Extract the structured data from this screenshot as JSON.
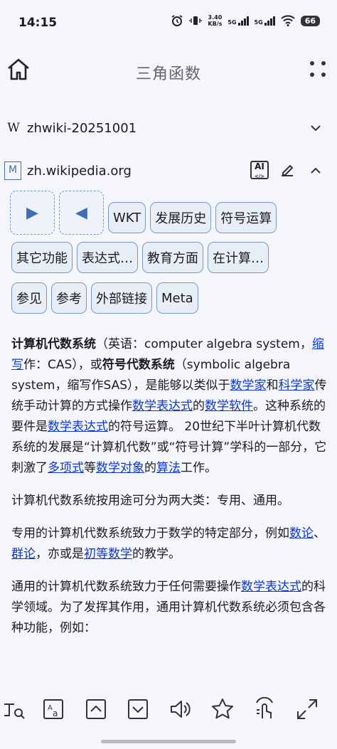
{
  "status_bar": {
    "time": "14:15",
    "net_speed_value": "3.40",
    "net_speed_unit": "KB/s",
    "sim1": "5G",
    "sim2": "5G",
    "battery": "66"
  },
  "app_bar": {
    "title": "三角函数"
  },
  "sources": [
    {
      "icon": "W",
      "label": "zhwiki-20251001"
    },
    {
      "icon": "M",
      "label": "zh.wikipedia.org"
    }
  ],
  "ai_label": "AI",
  "section_chips": {
    "row1": [
      "WKT",
      "发展历史",
      "符号运算"
    ],
    "row2": [
      "其它功能",
      "表达式…",
      "教育方面",
      "在计算…"
    ],
    "row3": [
      "参见",
      "参考",
      "外部链接",
      "Meta"
    ]
  },
  "article": {
    "p1": {
      "t1": "计算机代数系统",
      "t2": "（英语：computer algebra system，",
      "l1": "缩写",
      "t3": "作：CAS），或",
      "t4": "符号代数系统",
      "t5": "（symbolic algebra system，缩写作SAS），是能够以类似于",
      "l2": "数学家",
      "t6": "和",
      "l3": "科学家",
      "t7": "传统手动计算的方式操作",
      "l4": "数学表达式",
      "t8": "的",
      "l5": "数学软件",
      "t9": "。这种系统的要件是",
      "l6": "数学表达式",
      "t10": "的符号运算。 20世纪下半叶计算机代数系统的发展是“计算机代数”或“符号计算”学科的一部分，它刺激了",
      "l7": "多项式",
      "t11": "等",
      "l8": "数学对象",
      "t12": "的",
      "l9": "算法",
      "t13": "工作。"
    },
    "p2": "计算机代数系统按用途可分为两大类：专用、通用。",
    "p3": {
      "t1": "专用的计算机代数系统致力于数学的特定部分，例如",
      "l1": "数论",
      "t2": "、",
      "l2": "群论",
      "t3": "，亦或是",
      "l3": "初等数学",
      "t4": "的教学。"
    },
    "p4": {
      "t1": "通用的计算机代数系统致力于任何需要操作",
      "l1": "数学表达式",
      "t2": "的科学领域。为了发挥其作用，通用计算机代数系统必须包含各种功能，例如："
    }
  },
  "bottom_tools": [
    "text-search-icon",
    "font-size-icon",
    "page-up-icon",
    "page-down-icon",
    "read-aloud-icon",
    "star-icon",
    "touch-read-icon",
    "fullscreen-icon"
  ]
}
